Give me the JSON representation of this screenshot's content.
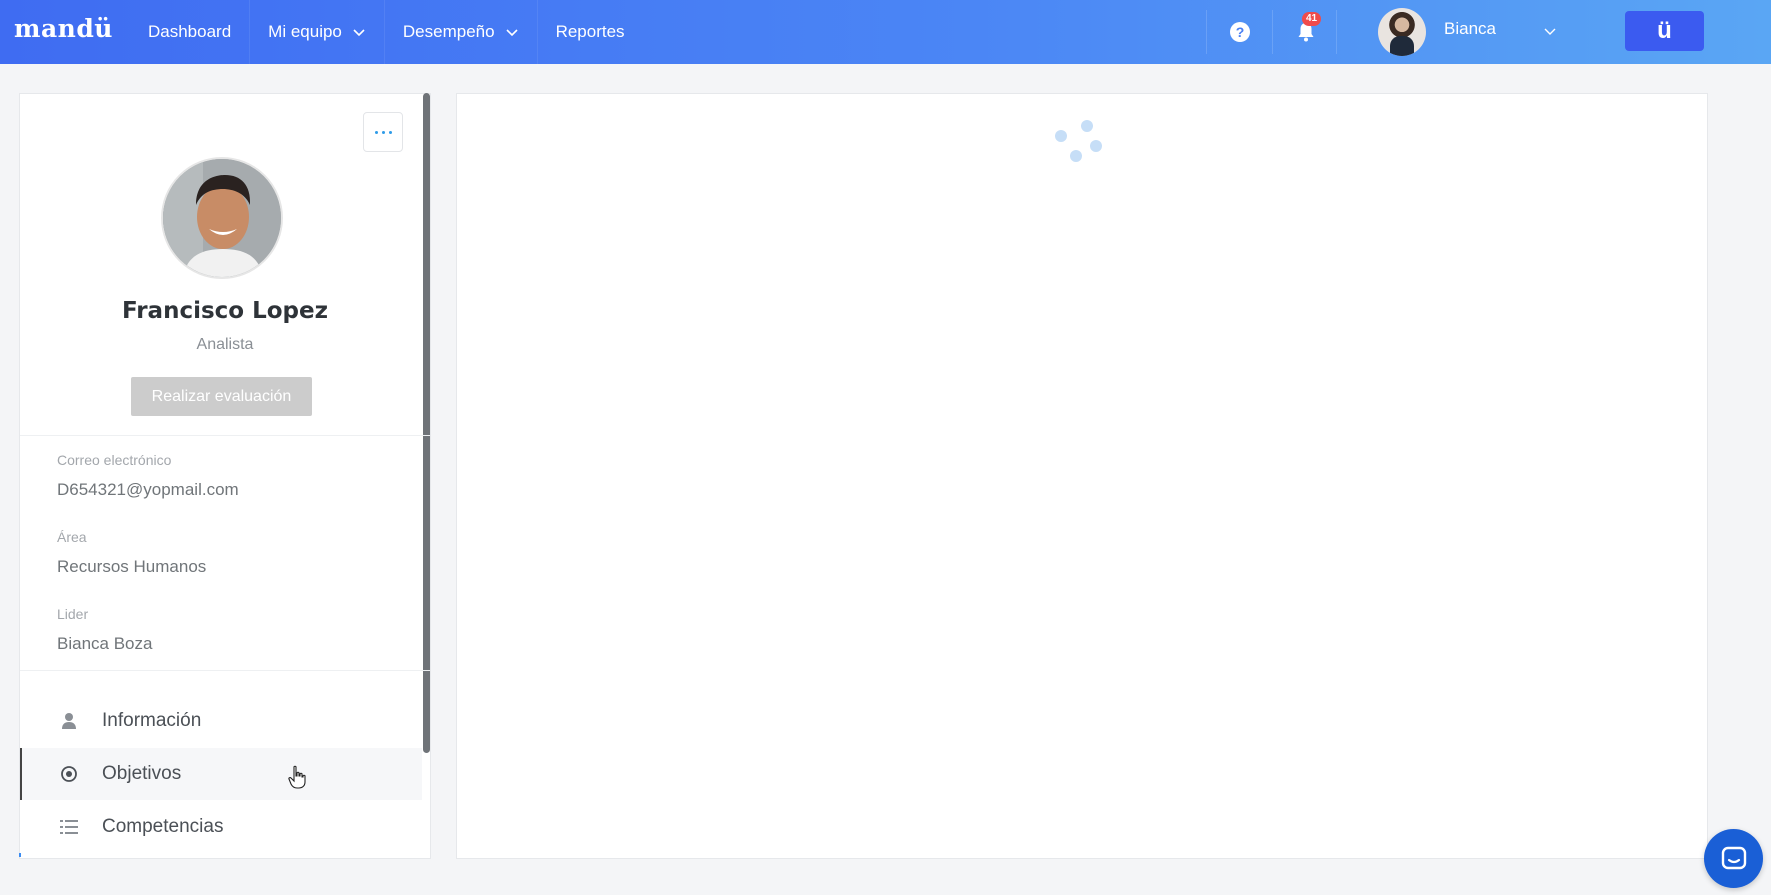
{
  "header": {
    "logo": "mandü",
    "nav": [
      {
        "label": "Dashboard",
        "dropdown": false
      },
      {
        "label": "Mi equipo",
        "dropdown": true
      },
      {
        "label": "Desempeño",
        "dropdown": true
      },
      {
        "label": "Reportes",
        "dropdown": false
      }
    ],
    "help_icon_text": "?",
    "notifications_count": "41",
    "user_name": "Bianca",
    "brand_button_label": "ü"
  },
  "profile": {
    "name": "Francisco Lopez",
    "role": "Analista",
    "evaluate_button": "Realizar evaluación",
    "fields": [
      {
        "label": "Correo electrónico",
        "value": "D654321@yopmail.com"
      },
      {
        "label": "Área",
        "value": "Recursos Humanos"
      },
      {
        "label": "Lider",
        "value": "Bianca Boza"
      }
    ],
    "menu": [
      {
        "label": "Información",
        "icon": "user-icon",
        "active": false
      },
      {
        "label": "Objetivos",
        "icon": "target-icon",
        "active": true
      },
      {
        "label": "Competencias",
        "icon": "list-icon",
        "active": false
      }
    ]
  },
  "colors": {
    "header_start": "#3f6cf2",
    "header_end": "#5aa6f4",
    "brand_button": "#3b5bf0",
    "badge": "#ef4b4b",
    "disabled_button": "#cccccc",
    "chat_button": "#1a5fd6"
  }
}
